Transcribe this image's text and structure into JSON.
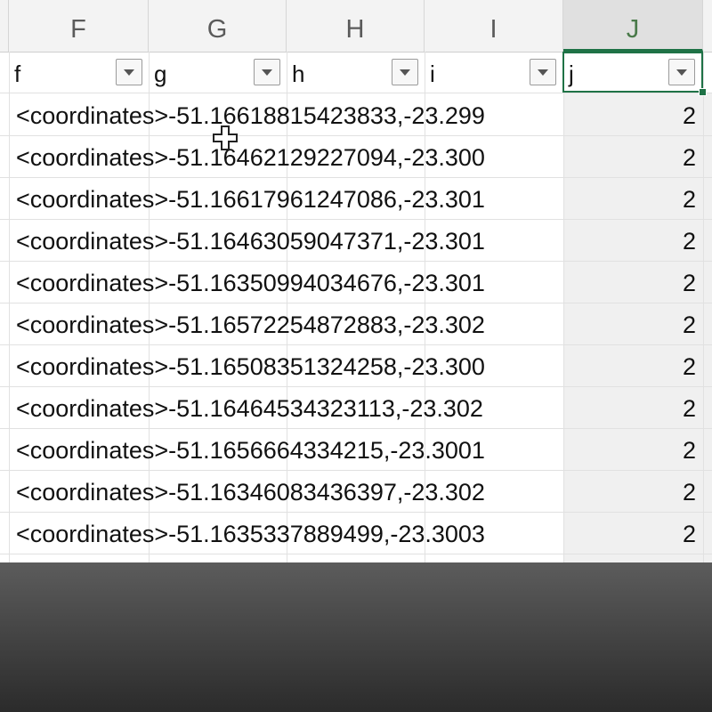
{
  "columns": [
    {
      "letter": "F",
      "filter_label": "f"
    },
    {
      "letter": "G",
      "filter_label": "g"
    },
    {
      "letter": "H",
      "filter_label": "h"
    },
    {
      "letter": "I",
      "filter_label": "i"
    },
    {
      "letter": "J",
      "filter_label": "j"
    }
  ],
  "rows": [
    {
      "text": "<coordinates>-51.16618815423833,-23.299",
      "value": "2"
    },
    {
      "text": "<coordinates>-51.16462129227094,-23.300",
      "value": "2"
    },
    {
      "text": "<coordinates>-51.16617961247086,-23.301",
      "value": "2"
    },
    {
      "text": "<coordinates>-51.16463059047371,-23.301",
      "value": "2"
    },
    {
      "text": "<coordinates>-51.16350994034676,-23.301",
      "value": "2"
    },
    {
      "text": "<coordinates>-51.16572254872883,-23.302",
      "value": "2"
    },
    {
      "text": "<coordinates>-51.16508351324258,-23.300",
      "value": "2"
    },
    {
      "text": "<coordinates>-51.16464534323113,-23.302",
      "value": "2"
    },
    {
      "text": "<coordinates>-51.1656664334215,-23.3001",
      "value": "2"
    },
    {
      "text": "<coordinates>-51.16346083436397,-23.302",
      "value": "2"
    },
    {
      "text": "<coordinates>-51.1635337889499,-23.3003",
      "value": "2"
    }
  ],
  "selected_column": "J",
  "icons": {
    "filter": "dropdown-arrow-icon",
    "cursor": "cell-select-cursor-icon"
  },
  "colors": {
    "selection": "#1f7246",
    "header_bg": "#f3f3f3"
  }
}
